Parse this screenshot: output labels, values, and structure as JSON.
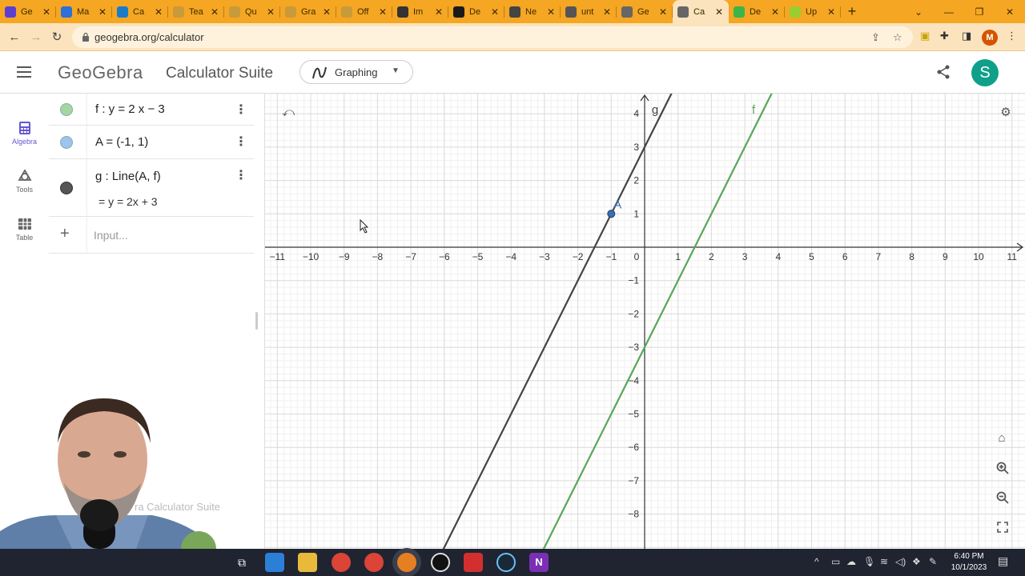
{
  "browser": {
    "tabs": [
      {
        "label": "Ge",
        "color": "#5b3fd1"
      },
      {
        "label": "Ma",
        "color": "#2e6fd8"
      },
      {
        "label": "Ca",
        "color": "#1a7cc7"
      },
      {
        "label": "Tea",
        "color": "#c89a3a"
      },
      {
        "label": "Qu",
        "color": "#c89a3a"
      },
      {
        "label": "Gra",
        "color": "#c89a3a"
      },
      {
        "label": "Off",
        "color": "#c89a3a"
      },
      {
        "label": "Im",
        "color": "#333333"
      },
      {
        "label": "De",
        "color": "#1a1a1a"
      },
      {
        "label": "Ne",
        "color": "#444444"
      },
      {
        "label": "unt",
        "color": "#555555"
      },
      {
        "label": "Ge",
        "color": "#666666"
      },
      {
        "label": "Ca",
        "color": "#666666",
        "active": true
      },
      {
        "label": "De",
        "color": "#3bb54a"
      },
      {
        "label": "Up",
        "color": "#9acd32"
      }
    ],
    "url": "geogebra.org/calculator",
    "profile_initial": "M"
  },
  "header": {
    "logo": "GeoGebra",
    "suite": "Calculator Suite",
    "app": "Graphing",
    "avatar_initial": "S",
    "accent": "#10a08a"
  },
  "rail": [
    {
      "label": "Algebra",
      "icon": "calculator-icon",
      "active": true
    },
    {
      "label": "Tools",
      "icon": "tools-icon"
    },
    {
      "label": "Table",
      "icon": "table-icon"
    }
  ],
  "algebra": {
    "rows": [
      {
        "expr": "f : y  =  2 x − 3",
        "color": "#a4d6a0"
      },
      {
        "expr": "A  =  (-1, 1)",
        "color": "#9cc4ee"
      },
      {
        "expr": "g : Line(A, f)",
        "output": "=  y  =  2x  +  3",
        "color": "#555555"
      }
    ],
    "input_placeholder": "Input..."
  },
  "watermark": "ra Calculator Suite",
  "graph": {
    "x_ticks": [
      -11,
      -10,
      -9,
      -8,
      -7,
      -6,
      -5,
      -4,
      -3,
      -2,
      -1,
      0,
      1,
      2,
      3,
      4,
      5,
      6,
      7,
      8,
      9,
      10,
      11
    ],
    "y_ticks": [
      4,
      3,
      2,
      1,
      -1,
      -2,
      -3,
      -4,
      -5,
      -6,
      -7,
      -8
    ],
    "lines": [
      {
        "name": "g",
        "slope": 2,
        "intercept": 3,
        "color": "#444444"
      },
      {
        "name": "f",
        "slope": 2,
        "intercept": -3,
        "color": "#5aa55a"
      }
    ],
    "point": {
      "name": "A",
      "x": -1,
      "y": 1,
      "color": "#3a6fb5"
    }
  },
  "taskbar": {
    "time": "6:40 PM",
    "date": "10/1/2023"
  }
}
